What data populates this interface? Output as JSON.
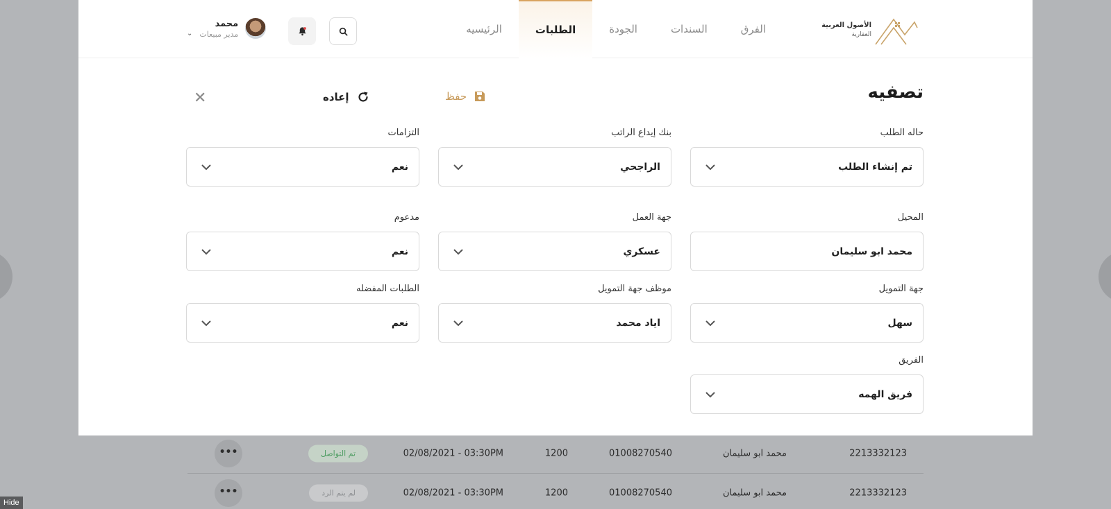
{
  "header": {
    "logo": {
      "title": "الأصول العربية",
      "subtitle": "العقارية"
    },
    "nav": [
      {
        "label": "الرئيسيه",
        "active": false
      },
      {
        "label": "الطلبات",
        "active": true
      },
      {
        "label": "الجودة",
        "active": false
      },
      {
        "label": "السندات",
        "active": false
      },
      {
        "label": "الفرق",
        "active": false
      }
    ],
    "user": {
      "name": "محمد",
      "role": "مدير مبيعات"
    }
  },
  "filter": {
    "title": "تصفيه",
    "save_label": "حفظ",
    "reset_label": "إعاده",
    "fields": [
      {
        "label": "حاله الطلب",
        "value": "تم إنشاء الطلب",
        "dropdown": true
      },
      {
        "label": "بنك إيداع الراتب",
        "value": "الراجحي",
        "dropdown": true
      },
      {
        "label": "التزامات",
        "value": "نعم",
        "dropdown": true
      },
      {
        "label": "المحيل",
        "value": "محمد ابو سليمان",
        "dropdown": false
      },
      {
        "label": "جهة العمل",
        "value": "عسكري",
        "dropdown": true
      },
      {
        "label": "مدعوم",
        "value": "نعم",
        "dropdown": true
      },
      {
        "label": "جهة التمويل",
        "value": "سهل",
        "dropdown": true
      },
      {
        "label": "موظف جهة التمويل",
        "value": "اياد محمد",
        "dropdown": true
      },
      {
        "label": "الطلبات المفضله",
        "value": "نعم",
        "dropdown": true
      },
      {
        "label": "الفريق",
        "value": "فريق الهمه",
        "dropdown": true
      }
    ]
  },
  "table": {
    "rows": [
      {
        "id": "2213332123",
        "name": "محمد ابو سليمان",
        "phone": "01008270540",
        "amount": "1200",
        "date": "02/08/2021 - 03:30PM",
        "status": "تم التواصل",
        "status_type": "ok"
      },
      {
        "id": "2213332123",
        "name": "محمد ابو سليمان",
        "phone": "01008270540",
        "amount": "1200",
        "date": "02/08/2021 - 03:30PM",
        "status": "لم يتم الرد",
        "status_type": "no"
      }
    ]
  },
  "hide_label": "Hide",
  "colors": {
    "accent": "#c79a5a",
    "nav_active_border": "#d9a35f",
    "status_ok": "#4f9d63"
  }
}
